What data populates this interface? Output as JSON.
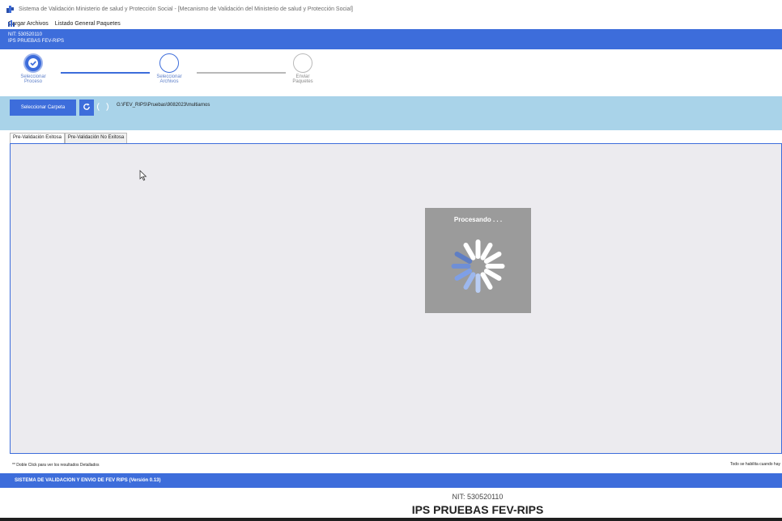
{
  "window": {
    "title": "Sistema de Validación Ministerio de salud y Protección Social - [Mecanismo de Validación del Ministerio de salud y Protección Social]"
  },
  "menu": {
    "items": [
      "Cargar Archivos",
      "Listado General Paquetes"
    ]
  },
  "header": {
    "nit": "NIT: 530520110",
    "ips": "IPS PRUEBAS FEV-RIPS"
  },
  "steps": [
    {
      "line1": "Seleccionar",
      "line2": "Proceso",
      "state": "active"
    },
    {
      "line1": "Seleccionar",
      "line2": "Archivos",
      "state": "current"
    },
    {
      "line1": "Enviar",
      "line2": "Paquetes",
      "state": "pending"
    }
  ],
  "toolbar": {
    "select_folder_label": "Seleccionar Carpeta",
    "path": "G:\\FEV_RIPS\\Pruebas\\9082023\\multiarnos"
  },
  "tabs": [
    {
      "label": "Pre-Validación Exitosa",
      "active": true
    },
    {
      "label": "Pre-Validación No Exitosa",
      "active": false
    }
  ],
  "loader": {
    "title": "Procesando . . ."
  },
  "hints": {
    "left": "** Doble Click para ver los resultados Detallados",
    "right": "Todo se habilita cuando hay"
  },
  "footer": {
    "system_label": "SISTEMA DE VALIDACION Y ENVIO DE FEV RIPS  (Versión 0.13)"
  },
  "bottom": {
    "nit": "NIT: 530520110",
    "name": "IPS PRUEBAS FEV-RIPS"
  },
  "colors": {
    "primary": "#3d6ddb",
    "toolbar_bg": "#a9d3e9",
    "panel_bg": "#ecebef",
    "loader_bg": "#9b9b9b"
  }
}
